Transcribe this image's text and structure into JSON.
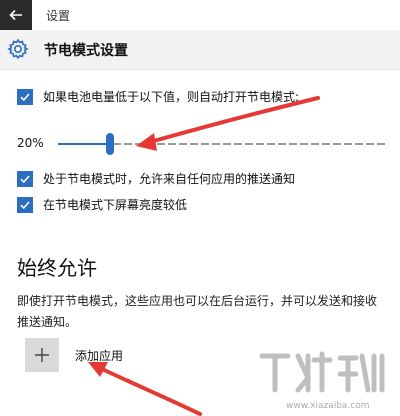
{
  "window": {
    "title": "设置"
  },
  "header": {
    "title": "节电模式设置"
  },
  "settings": {
    "auto_enable": {
      "label": "如果电池电量低于以下值，则自动打开节电模式:",
      "checked": true
    },
    "threshold": {
      "value_text": "20%",
      "value": 20,
      "min": 5,
      "max": 100
    },
    "allow_push": {
      "label": "处于节电模式时，允许来自任何应用的推送通知",
      "checked": true
    },
    "lower_brightness": {
      "label": "在节电模式下屏幕亮度较低",
      "checked": true
    }
  },
  "always_allow": {
    "title": "始终允许",
    "description": "即使打开节电模式，这些应用也可以在后台运行，并可以发送和接收推送通知。",
    "add_label": "添加应用"
  },
  "colors": {
    "accent": "#2c6ebf",
    "annotation": "#e53935"
  },
  "icons": {
    "back": "back-arrow-icon",
    "settings": "gear-icon",
    "add": "plus-icon",
    "check": "checkmark-icon"
  }
}
